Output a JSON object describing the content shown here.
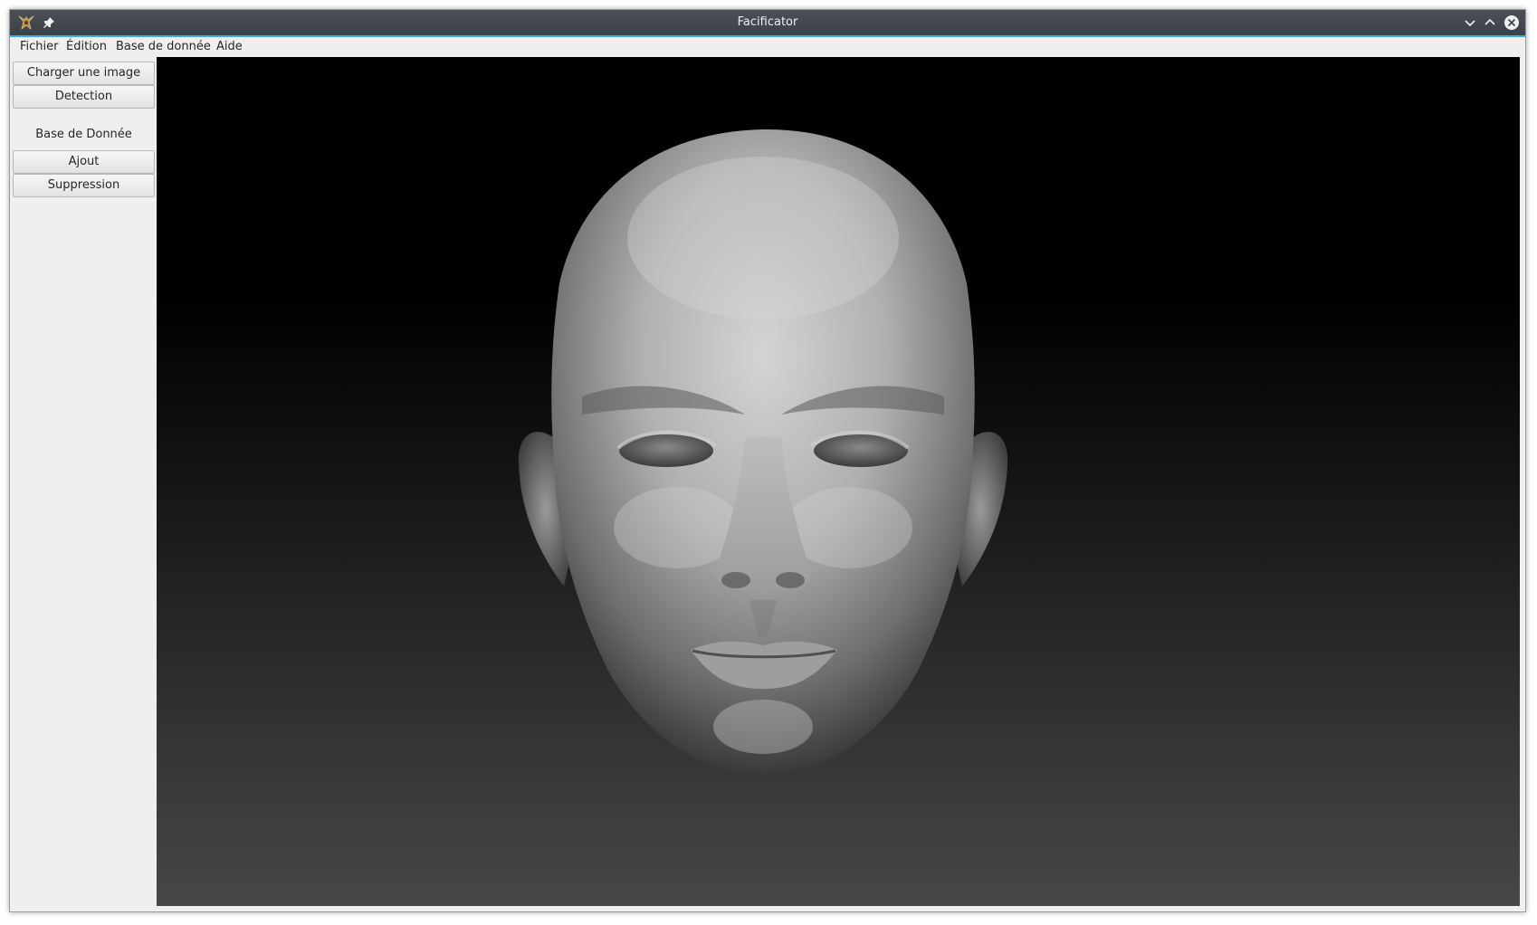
{
  "window": {
    "title": "Facificator"
  },
  "menubar": {
    "items": [
      "Fichier",
      "Édition",
      "Base de donnée",
      "Aide"
    ]
  },
  "sidebar": {
    "load_button": "Charger une image",
    "detect_button": "Detection",
    "db_section_label": "Base de Donnée",
    "add_button": "Ajout",
    "delete_button": "Suppression"
  },
  "viewport": {
    "content": "3d-head-model"
  },
  "colors": {
    "titlebar": "#3c4146",
    "accent": "#3daee9",
    "window_bg": "#efefef"
  }
}
